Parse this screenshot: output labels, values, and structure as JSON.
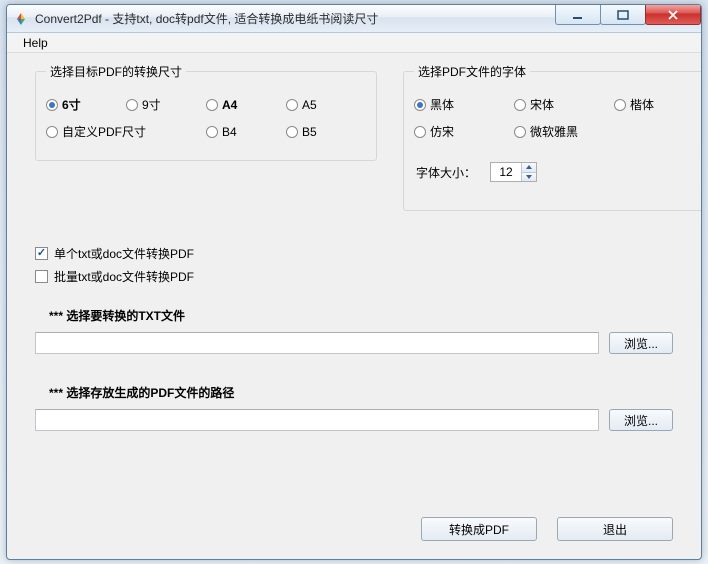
{
  "window": {
    "title": "Convert2Pdf - 支持txt, doc转pdf文件, 适合转换成电纸书阅读尺寸"
  },
  "menubar": {
    "help": "Help"
  },
  "size_group": {
    "legend": "选择目标PDF的转换尺寸",
    "opt_6": "6寸",
    "opt_9": "9寸",
    "opt_a4": "A4",
    "opt_a5": "A5",
    "opt_custom": "自定义PDF尺寸",
    "opt_b4": "B4",
    "opt_b5": "B5"
  },
  "font_group": {
    "legend": "选择PDF文件的字体",
    "opt_heiti": "黑体",
    "opt_songti": "宋体",
    "opt_kaiti": "楷体",
    "opt_fangsong": "仿宋",
    "opt_msyh": "微软雅黑",
    "size_label": "字体大小：",
    "size_value": "12"
  },
  "mode": {
    "single": "单个txt或doc文件转换PDF",
    "batch": "批量txt或doc文件转换PDF"
  },
  "txt_section": {
    "heading": "*** 选择要转换的TXT文件",
    "value": "",
    "browse": "浏览..."
  },
  "out_section": {
    "heading": "*** 选择存放生成的PDF文件的路径",
    "value": "",
    "browse": "浏览..."
  },
  "actions": {
    "convert": "转换成PDF",
    "exit": "退出"
  }
}
